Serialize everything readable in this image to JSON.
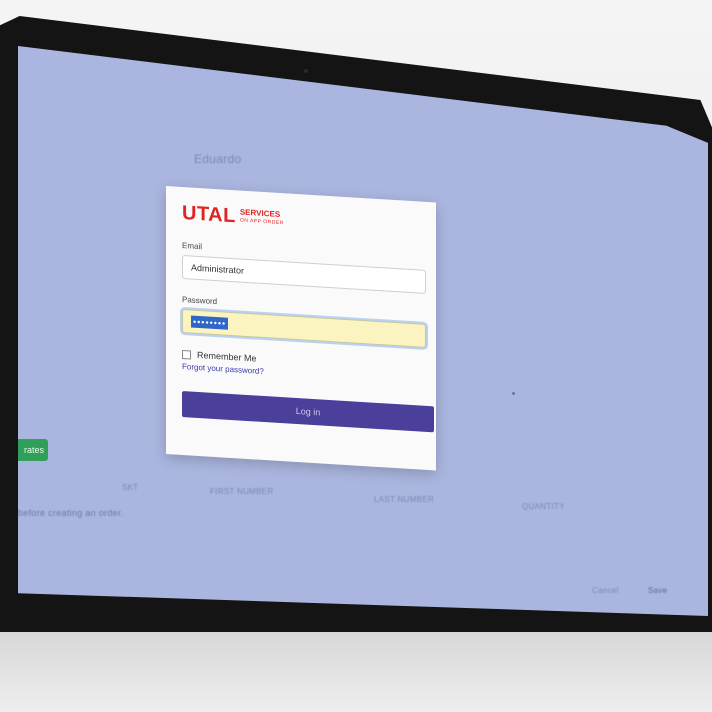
{
  "screen": {
    "nav_item_1": "Eduardo",
    "nav_item_2": "...",
    "green_button_label": "rates",
    "table_columns": [
      "SKT",
      "FIRST NUMBER",
      "LAST NUMBER",
      "QUANTITY"
    ],
    "empty_message": "before creating an order.",
    "footer_cancel": "Cancel",
    "footer_save": "Save"
  },
  "login": {
    "logo_main": "UTAL",
    "logo_sub_1": "SERVICES",
    "logo_sub_2": "ON APP ORDER",
    "email_label": "Email",
    "email_value": "Administrator",
    "password_label": "Password",
    "password_mask": "••••••••",
    "remember_label": "Remember Me",
    "forgot_link": "Forgot your password?",
    "submit_label": "Log in"
  },
  "colors": {
    "screen_bg": "#aab6df",
    "brand_red": "#e02424",
    "primary_button": "#4a3f9b",
    "autofill_yellow": "#fbf4c1",
    "green_button": "#2f9f5a"
  }
}
